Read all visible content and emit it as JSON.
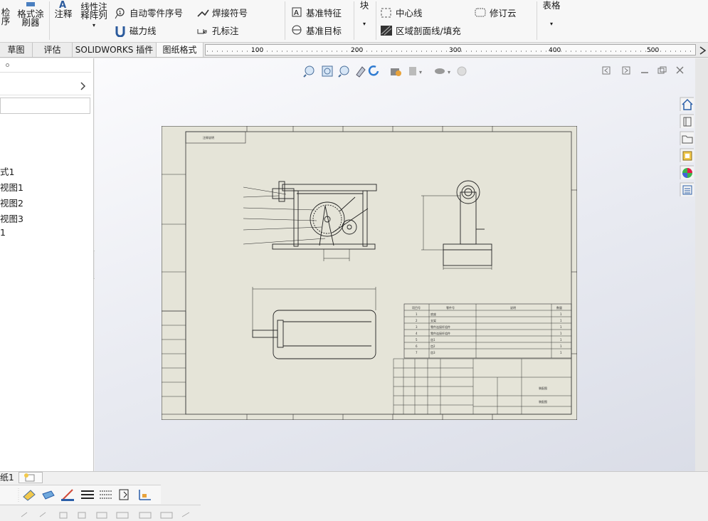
{
  "ribbon": {
    "check_order": "检\n序",
    "format_painter": "格式涂\n刷器",
    "annotation": "注释",
    "linear_note_array": "线性注\n释阵列",
    "auto_balloon": "自动零件序号",
    "magnetic_line": "磁力线",
    "weld_symbol": "焊接符号",
    "hole_callout": "孔标注",
    "datum_feature": "基准特征",
    "datum_target": "基准目标",
    "block": "块",
    "center_line": "中心线",
    "area_hatch": "区域剖面线/填充",
    "revision_cloud": "修订云",
    "table": "表格"
  },
  "tabs": [
    "草图",
    "评估",
    "SOLIDWORKS 插件",
    "图纸格式"
  ],
  "ruler": {
    "marks": [
      "100",
      "200",
      "300",
      "400",
      "500"
    ]
  },
  "tree": {
    "items": [
      "式1",
      "视图1",
      "视图2",
      "视图3",
      "1"
    ]
  },
  "drawing": {
    "notes": {
      "label": "注释说明"
    },
    "bom": {
      "headers": [
        "项目号",
        "零件号",
        "说明",
        "数量"
      ],
      "rows": [
        [
          "1",
          "底座",
          "",
          "1"
        ],
        [
          "2",
          "支架",
          "",
          "1"
        ],
        [
          "3",
          "零件连接杆组件",
          "",
          "1"
        ],
        [
          "4",
          "零件连接杆组件",
          "",
          "1"
        ],
        [
          "5",
          "齿1",
          "",
          "1"
        ],
        [
          "6",
          "齿2",
          "",
          "1"
        ],
        [
          "7",
          "齿3",
          "",
          "1"
        ]
      ]
    },
    "title_block": {
      "title": "装配图",
      "drawing_no": "装配图"
    }
  },
  "bottom": {
    "sheet_tab": "纸1",
    "colors": {
      "accent": "#1f6fc5",
      "tree_bg": "#ffffff",
      "viewport_top": "#fbfbfd",
      "viewport_bottom": "#dadde7"
    }
  }
}
